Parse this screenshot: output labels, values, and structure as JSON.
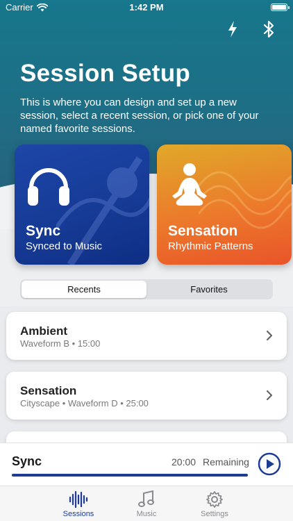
{
  "status_bar": {
    "carrier": "Carrier",
    "time": "1:42 PM"
  },
  "header": {
    "title": "Session Setup",
    "description": "This is where you can design and set up a new session, select a recent session, or pick one of your named favorite sessions.",
    "icons": [
      "lightning-icon",
      "bluetooth-icon"
    ]
  },
  "cards": [
    {
      "title": "Sync",
      "subtitle": "Synced to Music",
      "icon": "headphones-icon",
      "color": "#1d46a8"
    },
    {
      "title": "Sensation",
      "subtitle": "Rhythmic Patterns",
      "icon": "meditation-icon",
      "color": "#ec7a2b"
    }
  ],
  "segmented": {
    "options": [
      "Recents",
      "Favorites"
    ],
    "selected": "Recents"
  },
  "sessions": [
    {
      "title": "Ambient",
      "subtitle": "Waveform B • 15:00"
    },
    {
      "title": "Sensation",
      "subtitle": "Cityscape • Waveform D • 25:00"
    }
  ],
  "player": {
    "title": "Sync",
    "time": "20:00",
    "remaining_label": "Remaining",
    "progress": 1.0
  },
  "tabs": [
    {
      "label": "Sessions",
      "icon": "waveform-icon",
      "active": true
    },
    {
      "label": "Music",
      "icon": "music-note-icon",
      "active": false
    },
    {
      "label": "Settings",
      "icon": "gear-icon",
      "active": false
    }
  ],
  "colors": {
    "accent": "#1d3c92",
    "header_teal": "#17778c"
  }
}
